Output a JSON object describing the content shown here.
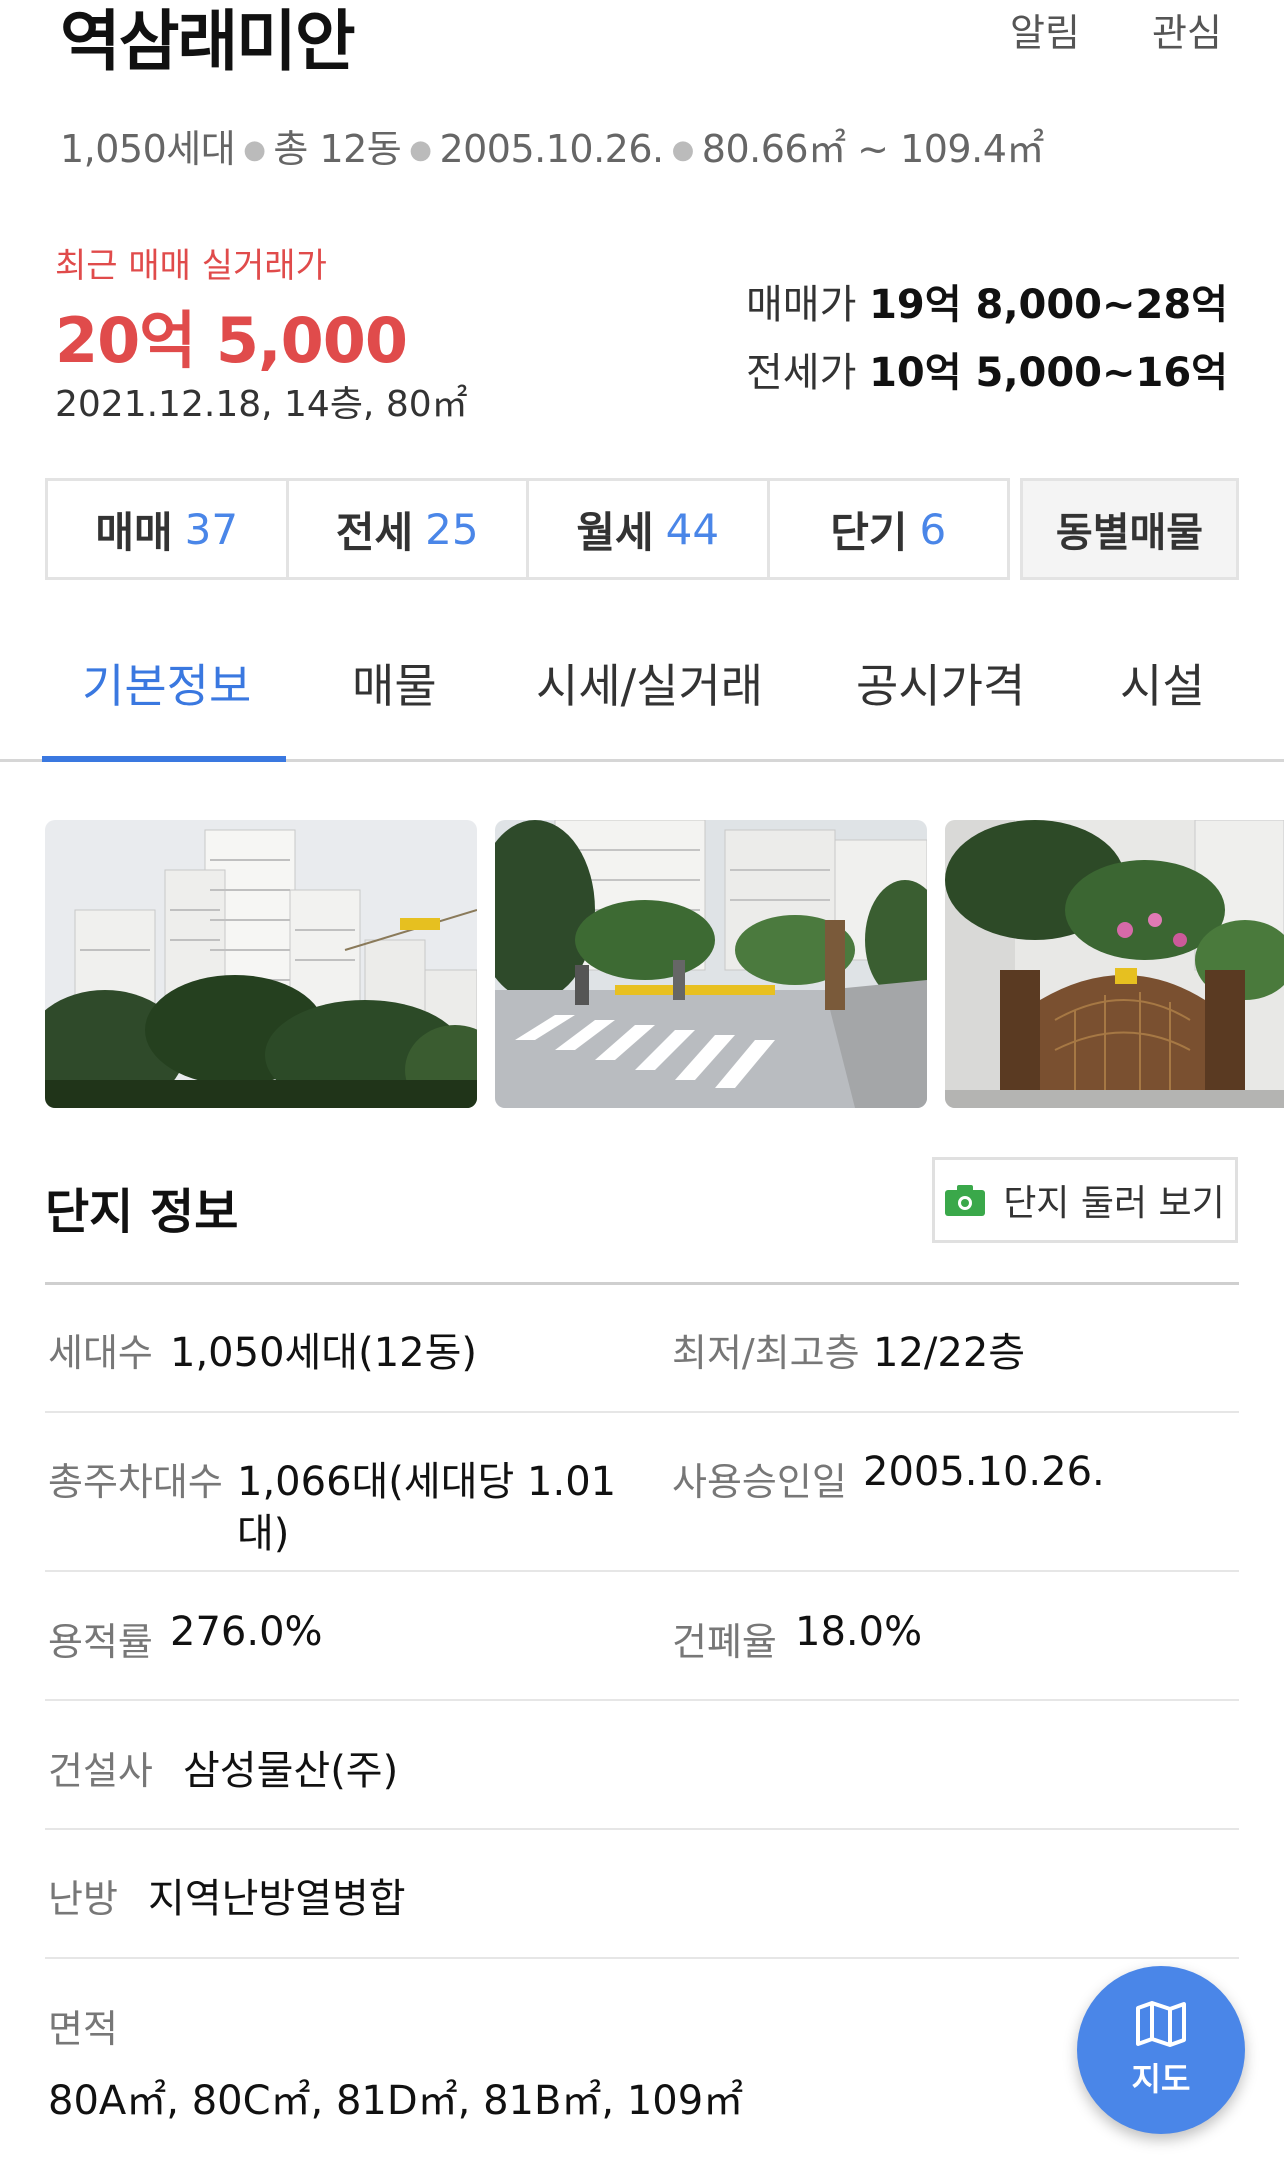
{
  "header": {
    "title": "역삼래미안",
    "alarm_label": "알림",
    "favorite_label": "관심",
    "summary": [
      "1,050세대",
      "총 12동",
      "2005.10.26.",
      "80.66㎡ ~ 109.4㎡"
    ]
  },
  "price": {
    "recent_label": "최근 매매 실거래가",
    "recent_value": "20억 5,000",
    "recent_detail": "2021.12.18, 14층, 80㎡",
    "sale_label": "매매가",
    "sale_range": "19억 8,000~28억",
    "jeonse_label": "전세가",
    "jeonse_range": "10억 5,000~16억"
  },
  "listing_counts": [
    {
      "label": "매매",
      "count": "37"
    },
    {
      "label": "전세",
      "count": "25"
    },
    {
      "label": "월세",
      "count": "44"
    },
    {
      "label": "단기",
      "count": "6"
    }
  ],
  "dong_button_label": "동별매물",
  "tabs": [
    "기본정보",
    "매물",
    "시세/실거래",
    "공시가격",
    "시설"
  ],
  "active_tab": "기본정보",
  "complex_info": {
    "title": "단지 정보",
    "tour_button": "단지 둘러 보기",
    "rows": {
      "households": {
        "label": "세대수",
        "value": "1,050세대(12동)"
      },
      "floors": {
        "label": "최저/최고층",
        "value": "12/22층"
      },
      "parking": {
        "label": "총주차대수",
        "value_line1": "1,066대(세대당 1.01",
        "value_line2": "대)"
      },
      "approval": {
        "label": "사용승인일",
        "value": "2005.10.26."
      },
      "far": {
        "label": "용적률",
        "value": "276.0%"
      },
      "bcr": {
        "label": "건폐율",
        "value": "18.0%"
      },
      "builder": {
        "label": "건설사",
        "value": "삼성물산(주)"
      },
      "heating": {
        "label": "난방",
        "value": "지역난방열병합"
      },
      "area": {
        "label": "면적",
        "value": "80A㎡, 80C㎡, 81D㎡, 81B㎡, 109㎡"
      }
    }
  },
  "map_button_label": "지도",
  "colors": {
    "accent_blue": "#3a78e0",
    "price_red": "#e04b4b",
    "fab_blue": "#4a86e8",
    "camera_green": "#3aa84a"
  }
}
